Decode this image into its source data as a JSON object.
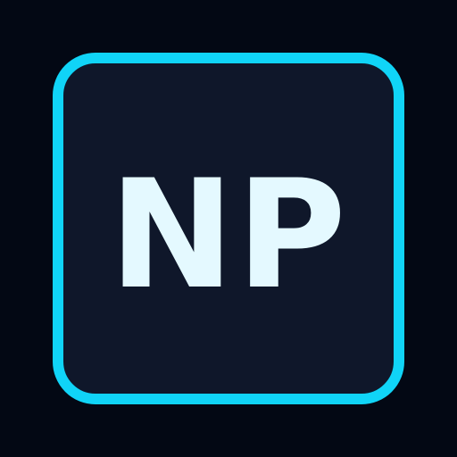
{
  "logo": {
    "text": "NP"
  },
  "colors": {
    "background": "#030814",
    "tile_fill": "#0f172a",
    "tile_border": "#10d4f7",
    "text": "#e4f9ff"
  }
}
